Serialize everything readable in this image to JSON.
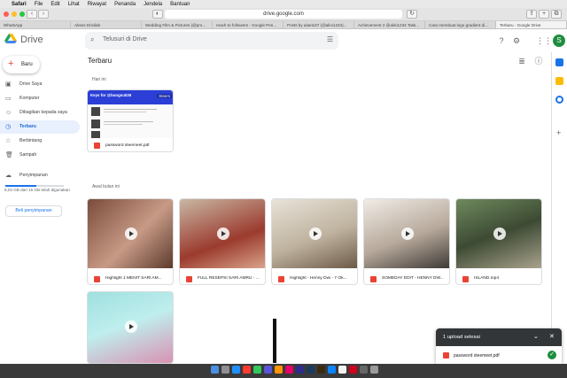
{
  "menubar": {
    "apple": "",
    "items": [
      "Safari",
      "File",
      "Edit",
      "Lihat",
      "Riwayat",
      "Penanda",
      "Jendela",
      "Bantuan"
    ]
  },
  "browser": {
    "url": "drive.google.com"
  },
  "tabs": [
    "WhatsApp",
    "Akses Drivilab",
    "Wedding Film & Pictures (@pro...",
    "reach to followers - Google Pen...",
    "Posts by alaeni37 (@alini1234)...",
    "Achievement 2 @alini1234 Task...",
    "Cara membuat logo gradient di...",
    "Terbaru - Google Drive"
  ],
  "header": {
    "app_name": "Drive",
    "search_placeholder": "Telusuri di Drive",
    "avatar_letter": "S"
  },
  "sidebar": {
    "new_label": "Baru",
    "items": [
      "Drive Saya",
      "Komputer",
      "Dibagikan kepada saya",
      "Terbaru",
      "Berbintang",
      "Sampah",
      "Penyimpanan"
    ],
    "storage_text": "8,03 GB dari 15 GB telah digunakan",
    "storage_fraction": 0.535,
    "buy_storage": "Beli penyimpanan"
  },
  "main": {
    "title": "Terbaru",
    "section_today": "Hari ini",
    "section_month": "Awal bulan ini",
    "today_file": {
      "name": "password steemeet.pdf",
      "doc_title": "Keys for @bungsu026",
      "doc_badge": "Steem"
    },
    "files": [
      "Highlight 1 MENIT SARI AM...",
      "FULL RESEPSI SARI AMRU - ...",
      "Highlight - Henny Dwi - 7 Ok...",
      "SOMEDAY EDIT - HENNY DW...",
      "ISLAND.mp4"
    ]
  },
  "upload": {
    "title": "1 upload selesai",
    "file": "password steemeet.pdf"
  }
}
